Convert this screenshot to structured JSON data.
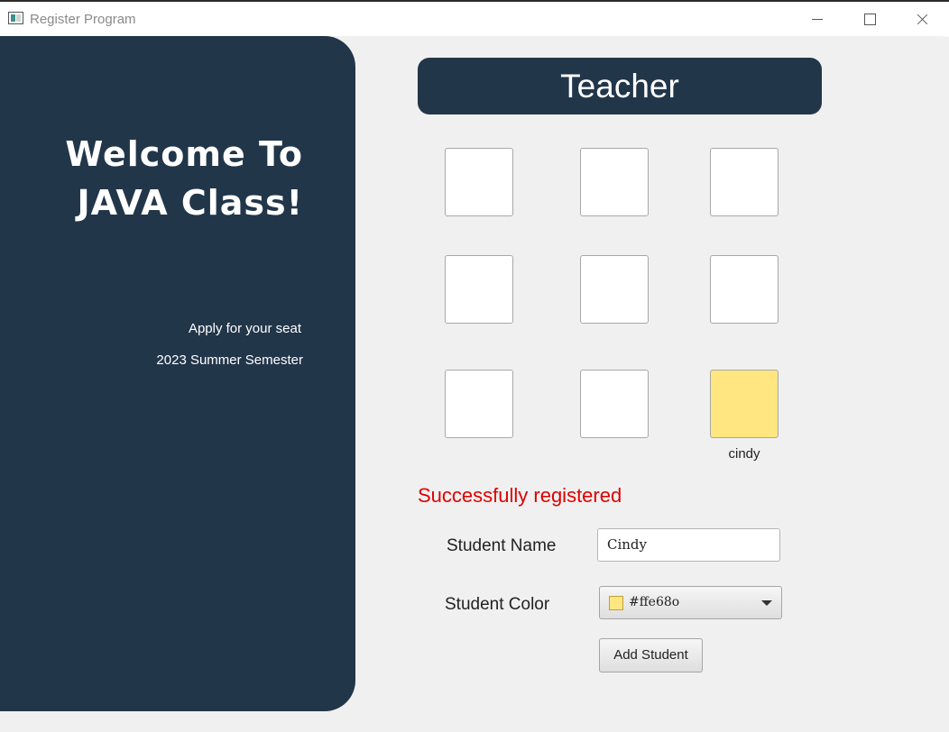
{
  "window": {
    "title": "Register Program"
  },
  "left_panel": {
    "welcome_line1": "Welcome To",
    "welcome_line2": "JAVA Class!",
    "subtitle1": "Apply for your seat",
    "subtitle2": "2023 Summer Semester",
    "background_color": "#22364a"
  },
  "teacher_label": "Teacher",
  "seats": [
    {
      "row": 1,
      "col": 1,
      "occupied": false,
      "student": "",
      "color": "#ffffff"
    },
    {
      "row": 1,
      "col": 2,
      "occupied": false,
      "student": "",
      "color": "#ffffff"
    },
    {
      "row": 1,
      "col": 3,
      "occupied": false,
      "student": "",
      "color": "#ffffff"
    },
    {
      "row": 2,
      "col": 1,
      "occupied": false,
      "student": "",
      "color": "#ffffff"
    },
    {
      "row": 2,
      "col": 2,
      "occupied": false,
      "student": "",
      "color": "#ffffff"
    },
    {
      "row": 2,
      "col": 3,
      "occupied": false,
      "student": "",
      "color": "#ffffff"
    },
    {
      "row": 3,
      "col": 1,
      "occupied": false,
      "student": "",
      "color": "#ffffff"
    },
    {
      "row": 3,
      "col": 2,
      "occupied": false,
      "student": "",
      "color": "#ffffff"
    },
    {
      "row": 3,
      "col": 3,
      "occupied": true,
      "student": "cindy",
      "color": "#ffe680"
    }
  ],
  "status_message": "Successfully registered",
  "status_color": "#e00000",
  "form": {
    "name_label": "Student Name",
    "name_value": "Cindy",
    "color_label": "Student Color",
    "color_value": "#ffe680",
    "color_display": "#ffe68o",
    "add_button_label": "Add Student"
  }
}
